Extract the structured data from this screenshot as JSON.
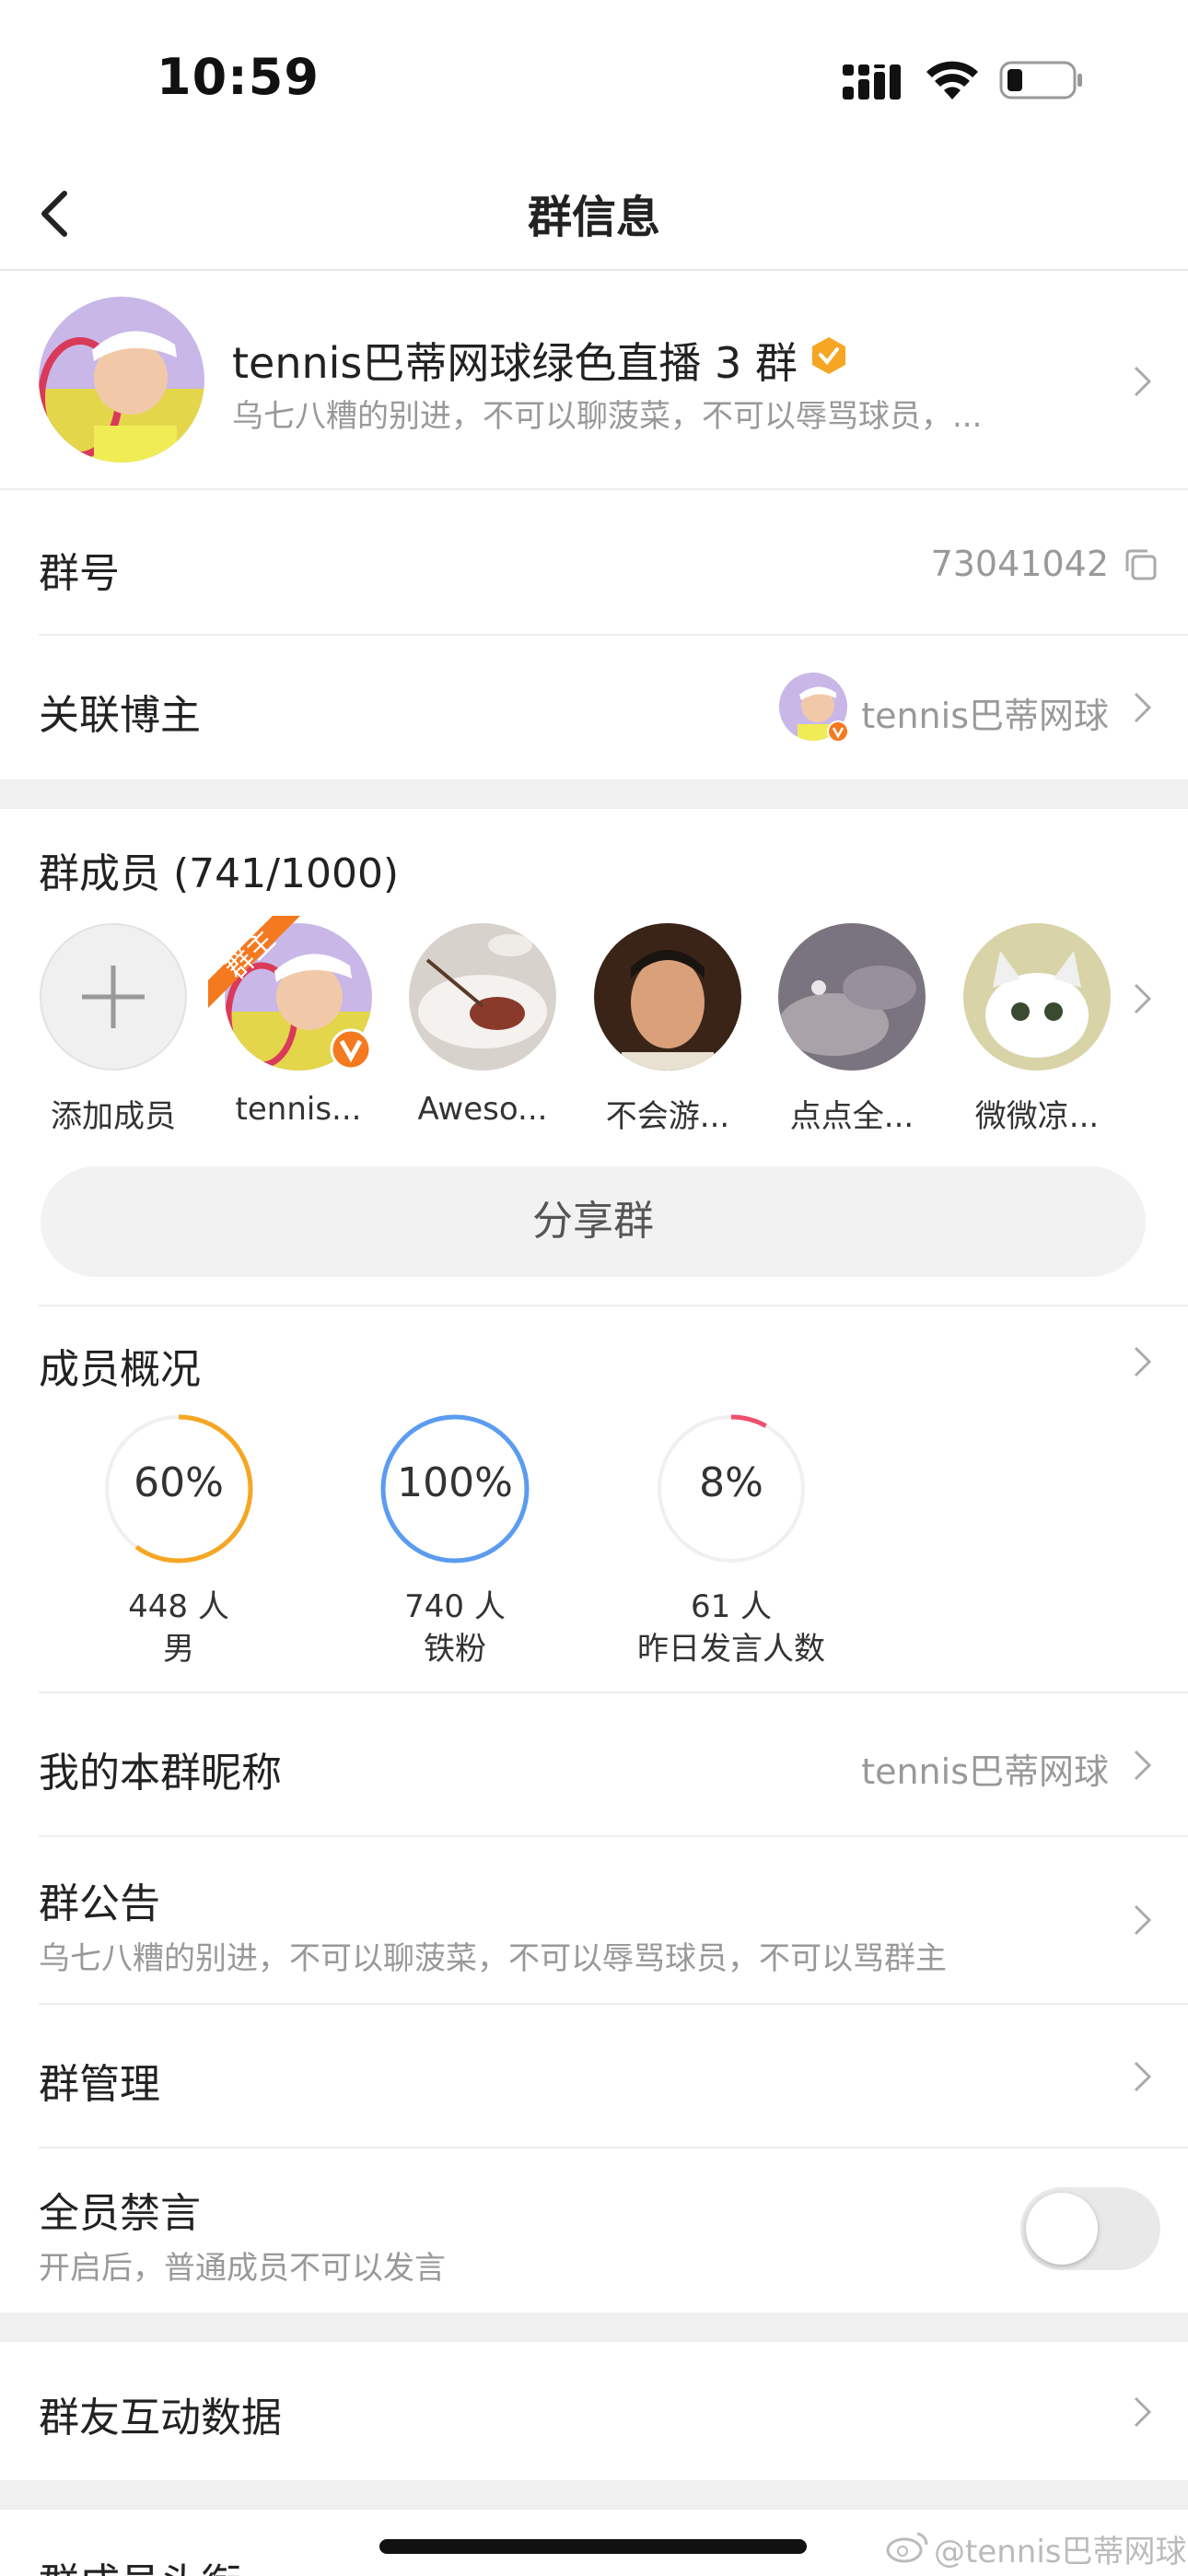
{
  "status_bar": {
    "time": "10:59"
  },
  "nav": {
    "title": "群信息"
  },
  "group": {
    "name": "tennis巴蒂网球绿色直播 3 群",
    "description": "乌七八糟的别进，不可以聊菠菜，不可以辱骂球员，..."
  },
  "group_number": {
    "label": "群号",
    "value": "73041042"
  },
  "linked_blogger": {
    "label": "关联博主",
    "value": "tennis巴蒂网球"
  },
  "members": {
    "title": "群成员 (741/1000)",
    "add_label": "添加成员",
    "owner_badge": "群主",
    "list": [
      {
        "name": "tennis..."
      },
      {
        "name": "Aweso..."
      },
      {
        "name": "不会游..."
      },
      {
        "name": "点点全..."
      },
      {
        "name": "微微凉..."
      }
    ],
    "share_label": "分享群"
  },
  "overview": {
    "title": "成员概况",
    "stats": [
      {
        "percent": "60%",
        "fraction": 0.6,
        "count": "448 人",
        "label": "男",
        "color": "#f5a623"
      },
      {
        "percent": "100%",
        "fraction": 1.0,
        "count": "740 人",
        "label": "铁粉",
        "color": "#5b9cf0"
      },
      {
        "percent": "8%",
        "fraction": 0.08,
        "count": "61 人",
        "label": "昨日发言人数",
        "color": "#f0506e"
      }
    ]
  },
  "nickname": {
    "label": "我的本群昵称",
    "value": "tennis巴蒂网球"
  },
  "announcement": {
    "label": "群公告",
    "text": "乌七八糟的别进，不可以聊菠菜，不可以辱骂球员，不可以骂群主"
  },
  "management": {
    "label": "群管理"
  },
  "mute_all": {
    "label": "全员禁言",
    "hint": "开启后，普通成员不可以发言",
    "enabled": false
  },
  "interaction": {
    "label": "群友互动数据"
  },
  "member_title_row": {
    "label": "群成员头衔"
  },
  "watermark": {
    "text": "@tennis巴蒂网球"
  }
}
